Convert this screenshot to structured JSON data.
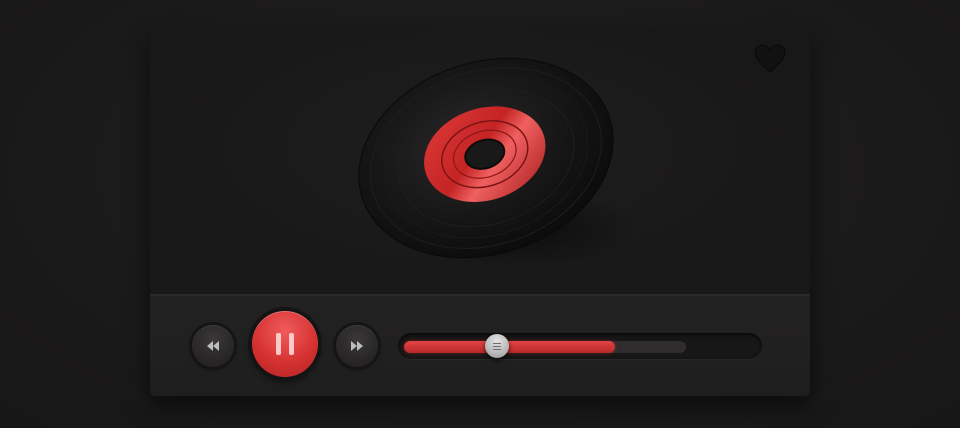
{
  "player": {
    "accent_color": "#d63232",
    "favorite_icon": "heart-icon",
    "artwork": "vinyl-record",
    "controls": {
      "rewind_icon": "rewind-icon",
      "play_state": "playing",
      "pause_icon": "pause-icon",
      "forward_icon": "fast-forward-icon"
    },
    "seek": {
      "played_fraction": 0.6,
      "buffered_fraction": 0.8
    }
  }
}
